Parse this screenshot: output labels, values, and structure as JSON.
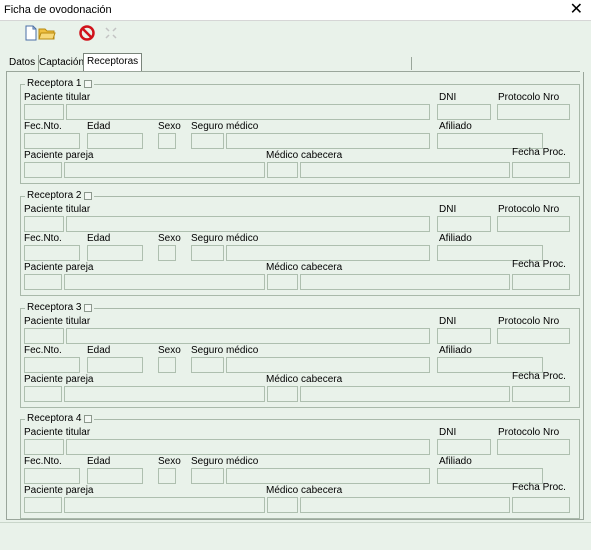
{
  "window": {
    "title": "Ficha de ovodonación"
  },
  "toolbar": {
    "icons": [
      "new-document-icon",
      "open-folder-icon",
      "cancel-icon",
      "disabled-icon"
    ]
  },
  "tabs": [
    {
      "label": "Datos"
    },
    {
      "label": "Captación"
    },
    {
      "label": "Receptoras",
      "active": true
    }
  ],
  "labels": {
    "paciente_titular": "Paciente titular",
    "dni": "DNI",
    "protocolo": "Protocolo Nro",
    "fec_nto": "Fec.Nto.",
    "edad": "Edad",
    "sexo": "Sexo",
    "seguro": "Seguro médico",
    "afiliado": "Afiliado",
    "pareja": "Paciente pareja",
    "medico": "Médico cabecera",
    "fecha_proc": "Fecha Proc."
  },
  "receptoras": [
    {
      "title": "Receptora 1"
    },
    {
      "title": "Receptora 2"
    },
    {
      "title": "Receptora 3"
    },
    {
      "title": "Receptora 4"
    }
  ]
}
